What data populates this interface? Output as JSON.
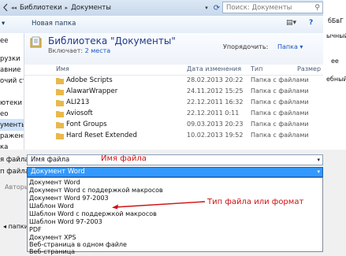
{
  "breadcrumb": [
    "Библиотеки",
    "Документы"
  ],
  "search": {
    "placeholder": "Поиск: Документы"
  },
  "toolbar": {
    "organize_tail": "▾",
    "new_folder": "Новая папка"
  },
  "nav": [
    {
      "label": "ее"
    },
    {
      "label": "рузки"
    },
    {
      "label": "авние места"
    },
    {
      "label": "очий стол"
    },
    {
      "label": ""
    },
    {
      "label": "ютеки"
    },
    {
      "label": "ео"
    },
    {
      "label": "ументы"
    },
    {
      "label": "ражения"
    },
    {
      "label": "ка"
    }
  ],
  "library": {
    "title": "Библиотека \"Документы\"",
    "includes_label": "Включает:",
    "includes_link": "2 места",
    "arrange_label": "Упорядочить:",
    "arrange_value": "Папка ▾"
  },
  "columns": {
    "name": "Имя",
    "date": "Дата изменения",
    "type": "Тип",
    "size": "Размер"
  },
  "files": [
    {
      "name": "Adobe Scripts",
      "date": "28.02.2013 20:22",
      "type": "Папка с файлами"
    },
    {
      "name": "AlawarWrapper",
      "date": "24.11.2012 15:25",
      "type": "Папка с файлами"
    },
    {
      "name": "ALI213",
      "date": "22.12.2011 16:32",
      "type": "Папка с файлами"
    },
    {
      "name": "Aviosoft",
      "date": "22.12.2011 0:11",
      "type": "Папка с файлами"
    },
    {
      "name": "Font Groups",
      "date": "09.03.2013 20:23",
      "type": "Папка с файлами"
    },
    {
      "name": "Hard Reset Extended",
      "date": "10.02.2013 19:52",
      "type": "Папка с файлами"
    }
  ],
  "save": {
    "filename_label": "я файла:",
    "filename_value": "Имя файла",
    "filetype_label": "п файла:",
    "filetype_value": "Документ Word",
    "authors_label": "Авторы:",
    "hide_folders": "папки"
  },
  "annotations": {
    "name_note": "Имя файла",
    "type_note": "Тип файла  или формат"
  },
  "type_options": [
    "Документ Word",
    "Документ Word с поддержкой макросов",
    "Документ Word 97-2003",
    "Шаблон Word",
    "Шаблон Word с поддержкой макросов",
    "Шаблон Word 97-2003",
    "PDF",
    "Документ XPS",
    "Веб-страница в одном файле",
    "Веб-страница"
  ],
  "right_strip": [
    "бБвГ",
    "ычный",
    "ее",
    "ебный"
  ],
  "colors": {
    "accent": "#3399ff",
    "annotation": "#d01010",
    "folder": "#e8b84a"
  }
}
